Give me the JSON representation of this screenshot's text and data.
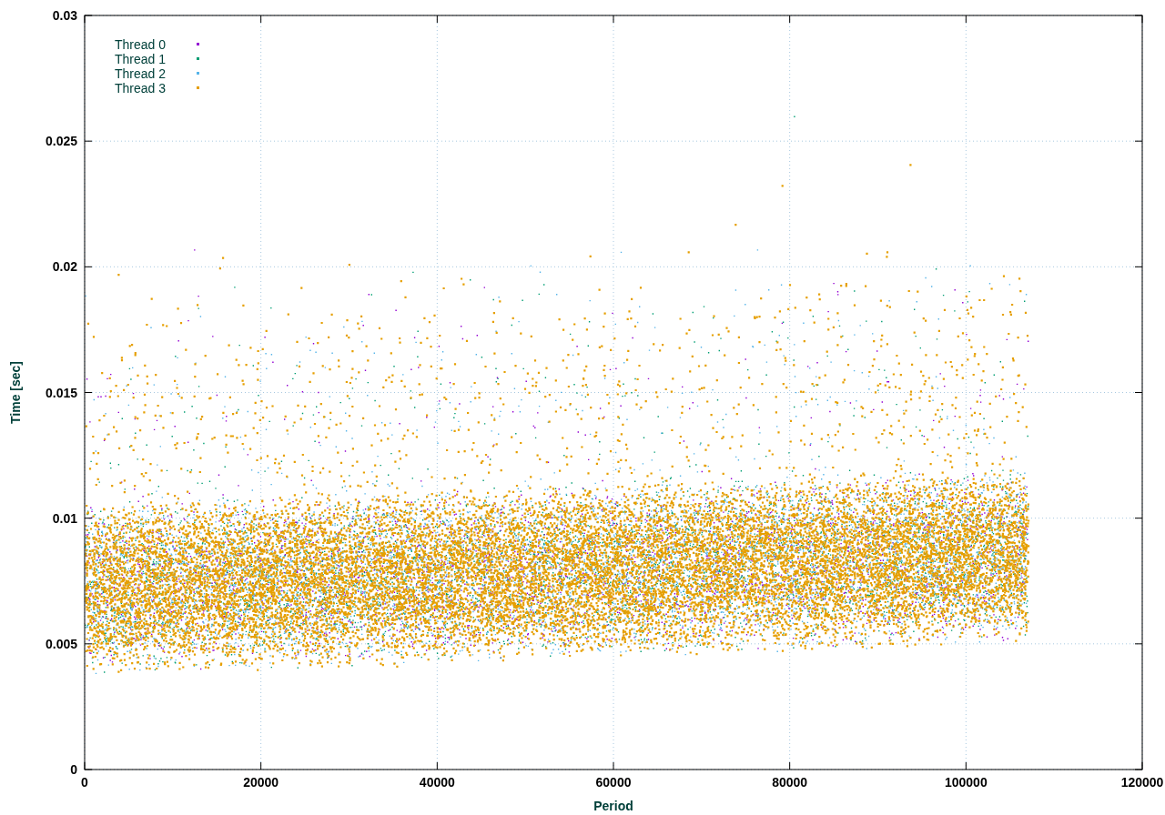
{
  "plot": {
    "legend": [
      {
        "name": "Thread 0",
        "color": "#9400d3"
      },
      {
        "name": "Thread 1",
        "color": "#009e73"
      },
      {
        "name": "Thread 2",
        "color": "#56b4e9"
      },
      {
        "name": "Thread 3",
        "color": "#e69f00"
      }
    ],
    "y_axis": {
      "title": "Time [sec]",
      "ticks": [
        "0.03",
        "0.025",
        "0.02",
        "0.015",
        "0.01",
        "0.005",
        "0"
      ]
    },
    "x_axis": {
      "title": "Period",
      "ticks": [
        "0",
        "20000",
        "40000",
        "60000",
        "80000",
        "100000",
        "120000"
      ]
    }
  }
}
